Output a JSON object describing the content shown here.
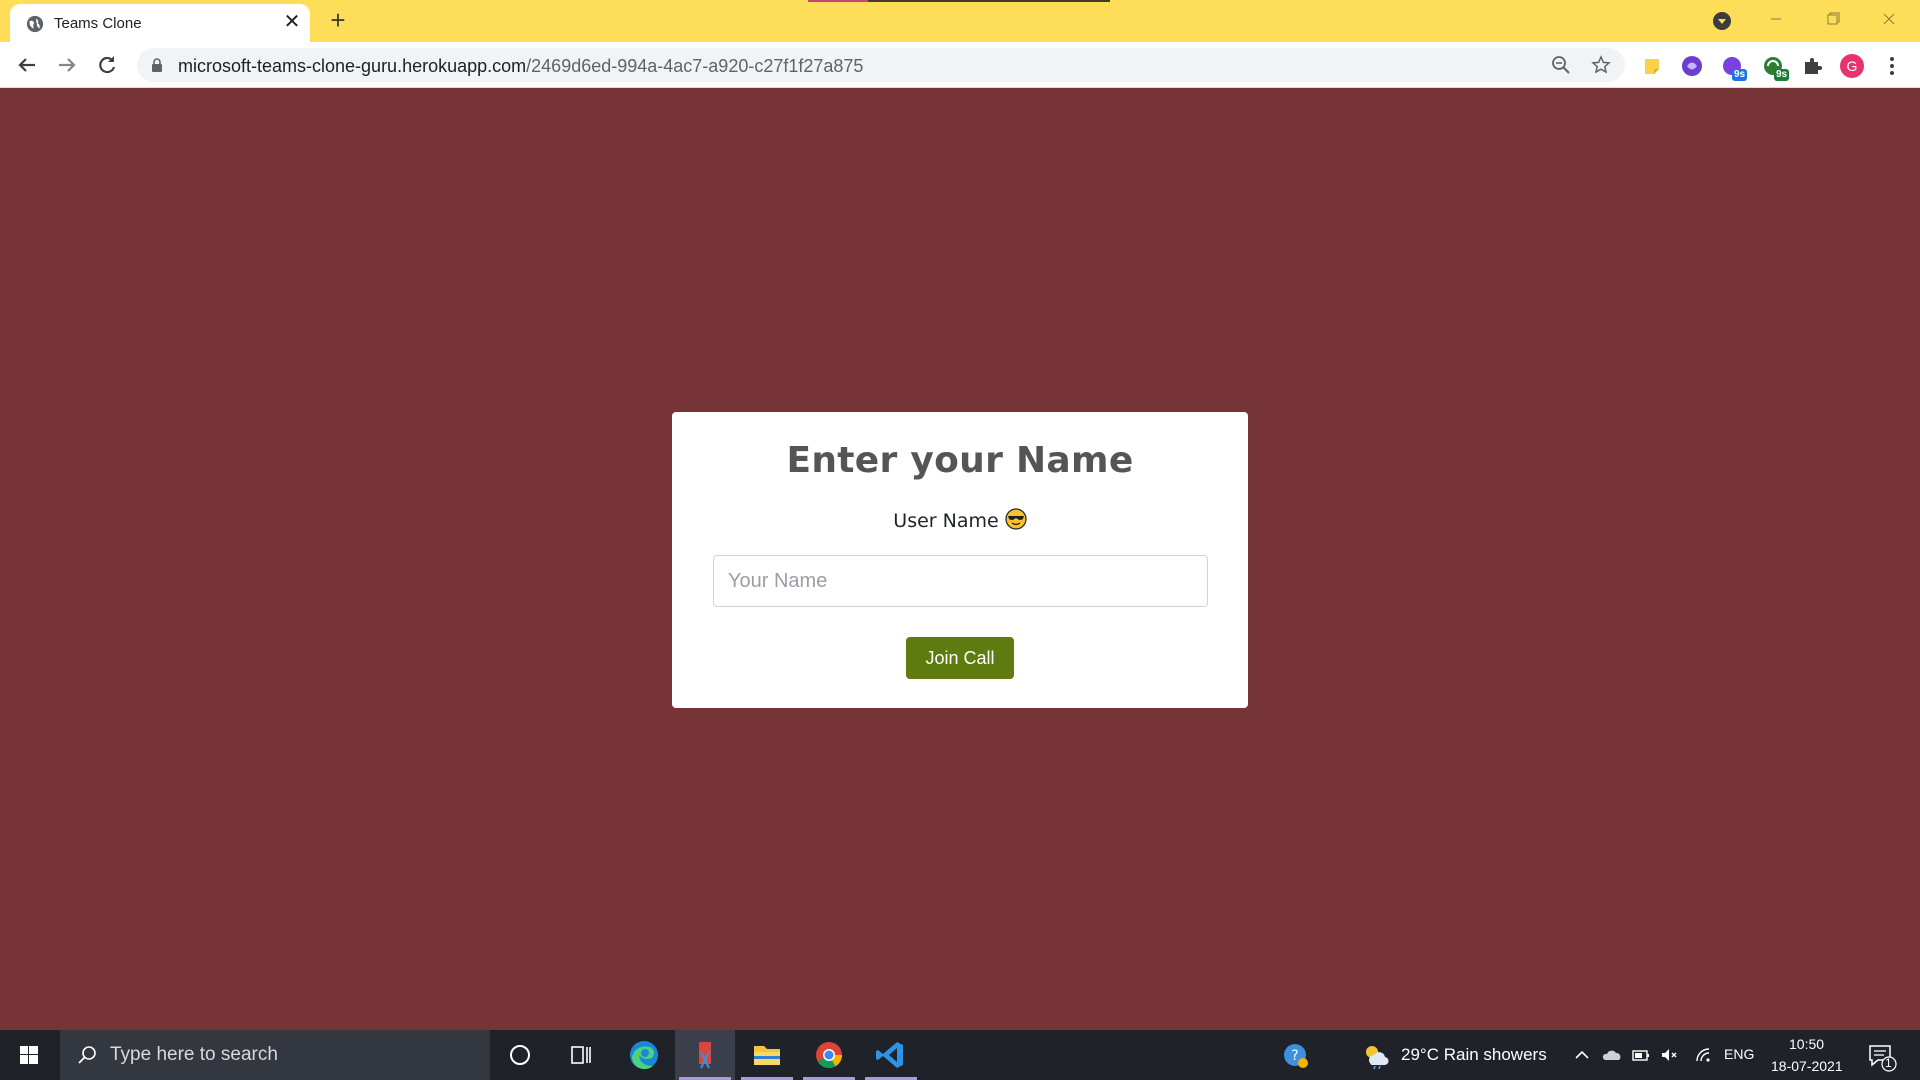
{
  "browser": {
    "tab_title": "Teams Clone",
    "url_host": "microsoft-teams-clone-guru.herokuapp.com",
    "url_path": "/2469d6ed-994a-4ac7-a920-c27f1f27a875",
    "ext_badge_1": "9s",
    "ext_badge_2": "9s",
    "profile_initial": "G",
    "theme_color": "#fede59"
  },
  "page": {
    "background_color": "#773436",
    "title": "Enter your Name",
    "label": "User Name",
    "input_placeholder": "Your Name",
    "input_value": "",
    "join_button": "Join Call",
    "join_button_color": "#5e7b0f"
  },
  "taskbar": {
    "search_placeholder": "Type here to search",
    "weather": "29°C  Rain showers",
    "language": "ENG",
    "time": "10:50",
    "date": "18-07-2021",
    "notification_count": "1"
  }
}
